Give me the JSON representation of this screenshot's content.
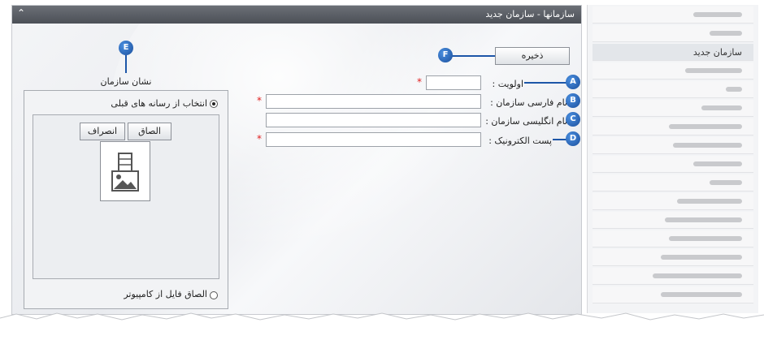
{
  "window": {
    "title": "سازمانها - سازمان جدید",
    "collapse_glyph": "⌃"
  },
  "sidebar": {
    "active_label": "سازمان جدید"
  },
  "form": {
    "save_label": "ذخیره",
    "priority_label": "اولویت :",
    "fa_name_label": "نام فارسی سازمان :",
    "en_name_label": "نام انگلیسی سازمان :",
    "email_label": "پست الکترونیک :",
    "required_mark": "*"
  },
  "logo": {
    "heading": "نشان سازمان",
    "option_media": "انتخاب از رسانه های قبلی",
    "option_upload": "الصاق فایل از کامپیوتر",
    "attach_label": "الصاق",
    "cancel_label": "انصراف",
    "image_icon": "image-placeholder-icon"
  },
  "badges": {
    "a": "A",
    "b": "B",
    "c": "C",
    "d": "D",
    "e": "E",
    "f": "F"
  },
  "colors": {
    "badge": "#1b4f9c",
    "required": "#e02020",
    "titlebar": "#555a61"
  }
}
